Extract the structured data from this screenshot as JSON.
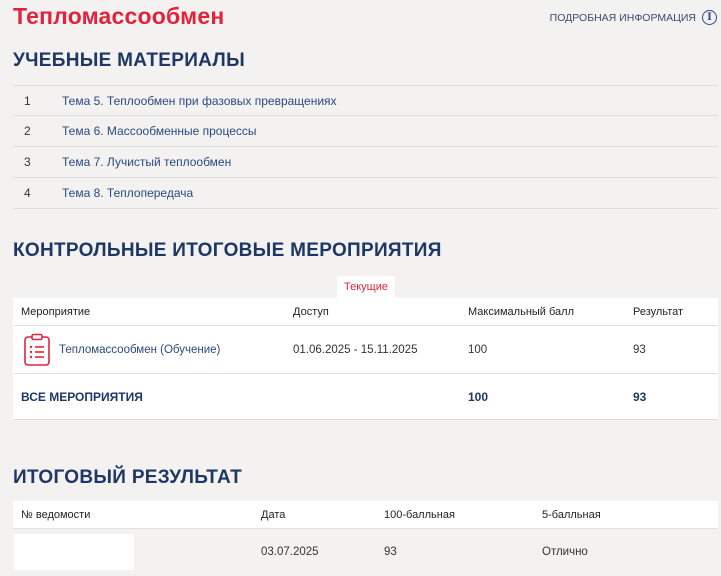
{
  "page": {
    "title": "Тепломассообмен",
    "info_link": "ПОДРОБНАЯ ИНФОРМАЦИЯ"
  },
  "materials": {
    "heading": "УЧЕБНЫЕ МАТЕРИАЛЫ",
    "items": [
      {
        "num": "1",
        "title": "Тема 5. Теплообмен при фазовых превращениях"
      },
      {
        "num": "2",
        "title": "Тема 6. Массообменные процессы"
      },
      {
        "num": "3",
        "title": "Тема 7. Лучистый теплообмен"
      },
      {
        "num": "4",
        "title": "Тема 8. Теплопередача"
      }
    ]
  },
  "events": {
    "heading": "КОНТРОЛЬНЫЕ ИТОГОВЫЕ МЕРОПРИЯТИЯ",
    "tab": "Текущие",
    "columns": {
      "event": "Мероприятие",
      "access": "Доступ",
      "max": "Максимальный балл",
      "result": "Результат"
    },
    "rows": [
      {
        "name": "Тепломассообмен (Обучение)",
        "access": "01.06.2025 - 15.11.2025",
        "max": "100",
        "result": "93",
        "icon": "clipboard-icon"
      }
    ],
    "total": {
      "label": "ВСЕ МЕРОПРИЯТИЯ",
      "max": "100",
      "result": "93"
    }
  },
  "final": {
    "heading": "ИТОГОВЫЙ РЕЗУЛЬТАТ",
    "columns": {
      "sheet": "№ ведомости",
      "date": "Дата",
      "score100": "100-балльная",
      "score5": "5-балльная"
    },
    "rows": [
      {
        "sheet": "",
        "date": "03.07.2025",
        "score100": "93",
        "score5": "Отлично"
      }
    ]
  },
  "colors": {
    "brand_red": "#e0243b",
    "heading_navy": "#1e3764",
    "link_blue": "#2b4a80",
    "background": "#f3f2f1"
  }
}
